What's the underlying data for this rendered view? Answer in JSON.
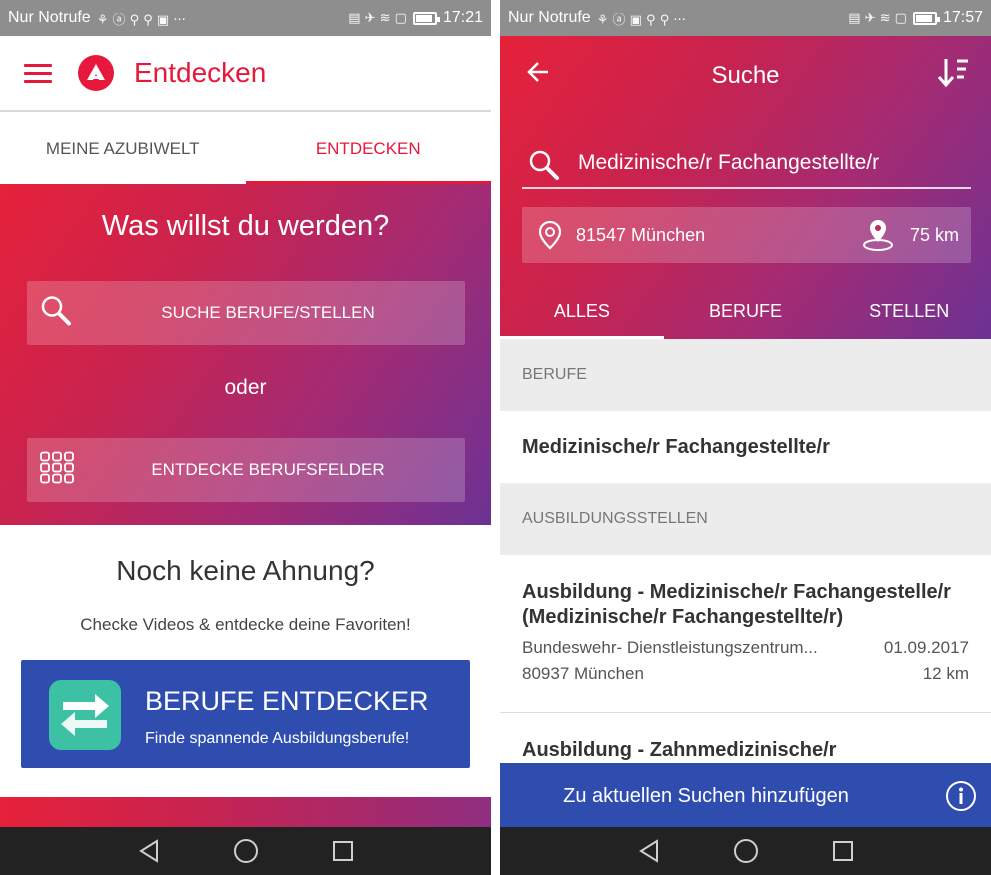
{
  "status_left": {
    "carrier": "Nur Notrufe",
    "time": "17:21"
  },
  "status_right": {
    "carrier": "Nur Notrufe",
    "time": "17:57"
  },
  "left": {
    "appbar_title": "Entdecken",
    "tabs": [
      "MEINE AZUBIWELT",
      "ENTDECKEN"
    ],
    "hero_title": "Was willst du werden?",
    "search_button": "SUCHE BERUFE/STELLEN",
    "or_label": "oder",
    "fields_button": "ENTDECKE BERUFSFELDER",
    "noidea_title": "Noch keine Ahnung?",
    "noidea_sub": "Checke Videos & entdecke deine Favoriten!",
    "promo_title": "BERUFE ENTDECKER",
    "promo_sub": "Finde spannende Ausbildungsberufe!"
  },
  "right": {
    "title": "Suche",
    "search_value": "Medizinische/r Fachangestellte/r",
    "location": "81547 München",
    "radius": "75 km",
    "tabs": [
      "ALLES",
      "BERUFE",
      "STELLEN"
    ],
    "section_berufe": "BERUFE",
    "beruf_item": "Medizinische/r Fachangestellte/r",
    "section_stellen": "AUSBILDUNGSSTELLEN",
    "listing1": {
      "title_line1": "Ausbildung - Medizinische/r Fachangestelle/r",
      "title_line2": "(Medizinische/r Fachangestellte/r)",
      "employer": "Bundeswehr- Dienstleistungszentrum...",
      "date": "01.09.2017",
      "place": "80937 München",
      "distance": "12 km"
    },
    "listing2": {
      "title_line1": "Ausbildung - Zahnmedizinische/r"
    },
    "cta": "Zu aktuellen Suchen hinzufügen"
  },
  "colors": {
    "brand_red": "#e6183b",
    "accent_blue": "#2f4dae",
    "teal": "#3cc1a5"
  }
}
